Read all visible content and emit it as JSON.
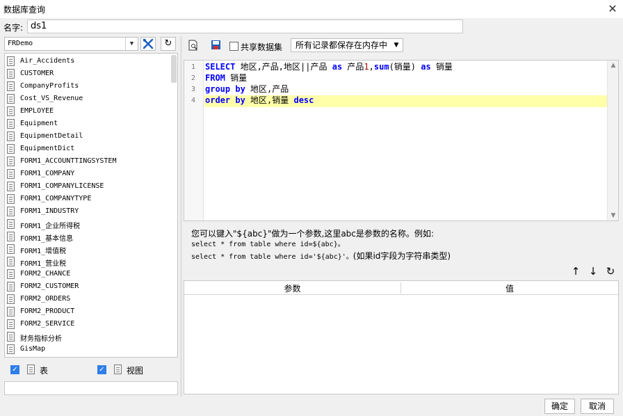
{
  "window": {
    "title": "数据库查询",
    "close_symbol": "✕"
  },
  "name_field": {
    "label": "名字:",
    "value": "ds1"
  },
  "datasource": {
    "selected": "FRDemo"
  },
  "tables": [
    "Air_Accidents",
    "CUSTOMER",
    "CompanyProfits",
    "Cost_VS_Revenue",
    "EMPLOYEE",
    "Equipment",
    "EquipmentDetail",
    "EquipmentDict",
    "FORM1_ACCOUNTTINGSYSTEM",
    "FORM1_COMPANY",
    "FORM1_COMPANYLICENSE",
    "FORM1_COMPANYTYPE",
    "FORM1_INDUSTRY",
    "FORM1_企业所得税",
    "FORM1_基本信息",
    "FORM1_增值税",
    "FORM1_营业税",
    "FORM2_CHANCE",
    "FORM2_CUSTOMER",
    "FORM2_ORDERS",
    "FORM2_PRODUCT",
    "FORM2_SERVICE",
    "财务指标分析",
    "GisMap"
  ],
  "filters": {
    "table_label": "表",
    "view_label": "视图"
  },
  "toolbar": {
    "share_label": "共享数据集",
    "mode_selected": "所有记录都保存在内存中"
  },
  "sql": {
    "line_numbers": [
      "1",
      "2",
      "3",
      "4"
    ],
    "lines": [
      [
        {
          "t": "kw",
          "v": "SELECT"
        },
        {
          "t": "p",
          "v": " 地区,产品,地区||产品 "
        },
        {
          "t": "kw",
          "v": "as"
        },
        {
          "t": "p",
          "v": " 产品"
        },
        {
          "t": "num",
          "v": "1"
        },
        {
          "t": "p",
          "v": ","
        },
        {
          "t": "kw",
          "v": "sum"
        },
        {
          "t": "p",
          "v": "(销量) "
        },
        {
          "t": "kw",
          "v": "as"
        },
        {
          "t": "p",
          "v": " 销量"
        }
      ],
      [
        {
          "t": "kw",
          "v": "FROM"
        },
        {
          "t": "p",
          "v": " 销量"
        }
      ],
      [
        {
          "t": "kw",
          "v": "group by"
        },
        {
          "t": "p",
          "v": " 地区,产品"
        }
      ],
      [
        {
          "t": "kw",
          "v": "order by"
        },
        {
          "t": "p",
          "v": " 地区,销量 "
        },
        {
          "t": "kw",
          "v": "desc"
        }
      ]
    ]
  },
  "hint": {
    "line1": "您可以键入\"${abc}\"做为一个参数,这里abc是参数的名称。例如:",
    "line2": "select * from table where id=${abc}。",
    "line3a": "select * from table where id='${abc}'。",
    "line3b": "(如果id字段为字符串类型)"
  },
  "params": {
    "col_name": "参数",
    "col_value": "值"
  },
  "buttons": {
    "ok": "确定",
    "cancel": "取消"
  }
}
